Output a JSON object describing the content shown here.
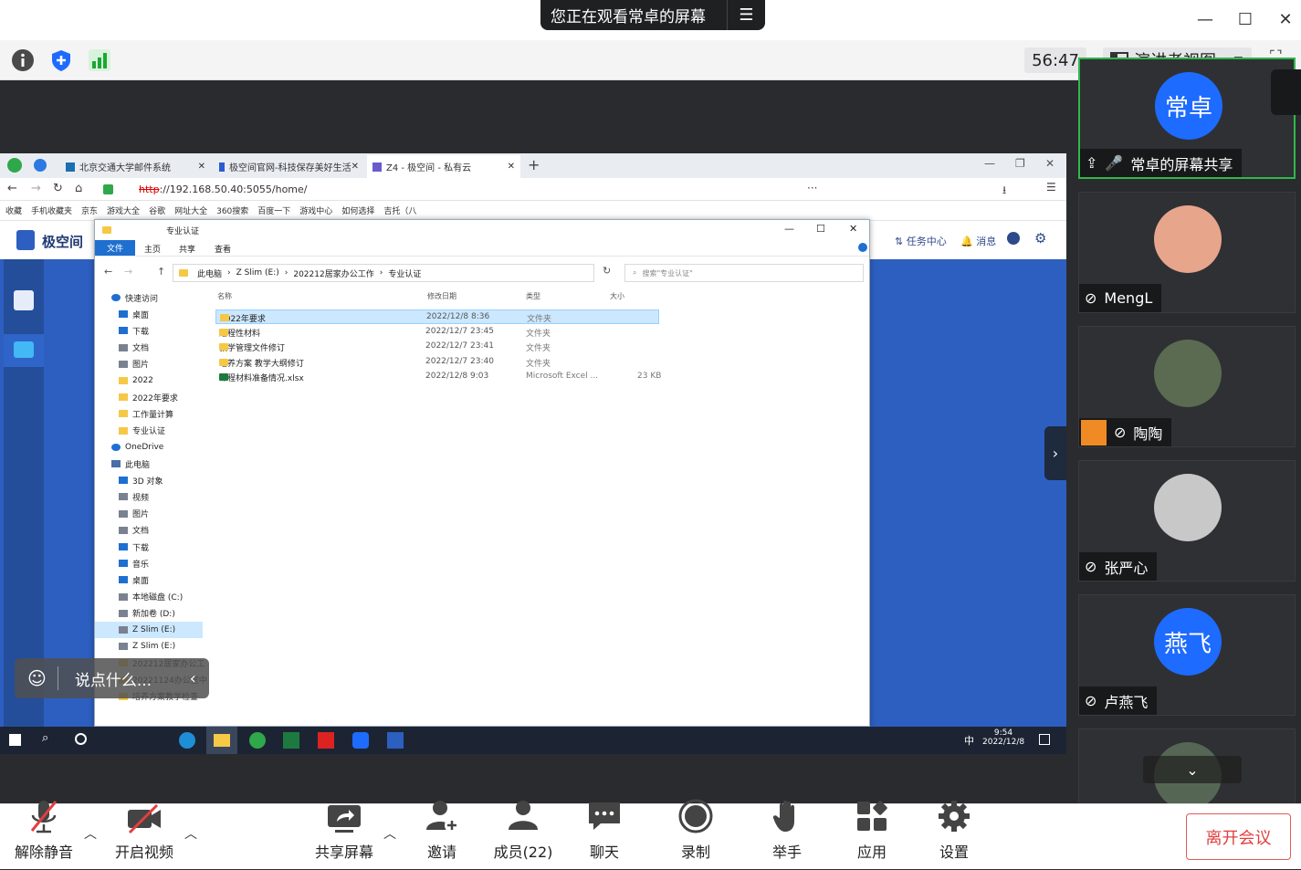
{
  "window": {
    "banner": "您正在观看常卓的屏幕",
    "controls": [
      "minimize",
      "maximize",
      "close"
    ]
  },
  "toolbar": {
    "timer": "56:47",
    "view_mode": "演讲者视图"
  },
  "browser": {
    "tabs": [
      {
        "label": "北京交通大学邮件系统"
      },
      {
        "label": "极空间官网-科技保存美好生活"
      },
      {
        "label": "Z4 - 极空间 - 私有云"
      }
    ],
    "url_scheme": "http",
    "url_rest": "://192.168.50.40:5055/home/",
    "bookmarks": [
      "收藏",
      "手机收藏夹",
      "京东",
      "游戏大全",
      "谷歌",
      "网址大全",
      "360搜索",
      "百度一下",
      "游戏中心",
      "如何选择",
      "吉托（八"
    ]
  },
  "webapp": {
    "logo": "极空间",
    "task_center": "任务中心",
    "messages": "消息"
  },
  "explorer": {
    "title": "专业认证",
    "ribbon": [
      "文件",
      "主页",
      "共享",
      "查看"
    ],
    "breadcrumb": [
      "此电脑",
      "Z Slim (E:)",
      "202212居家办公工作",
      "专业认证"
    ],
    "search_placeholder": "搜索\"专业认证\"",
    "columns": [
      "名称",
      "修改日期",
      "类型",
      "大小"
    ],
    "files": [
      {
        "name": "2022年要求",
        "date": "2022/12/8 8:36",
        "type": "文件夹",
        "size": ""
      },
      {
        "name": "过程性材料",
        "date": "2022/12/7 23:45",
        "type": "文件夹",
        "size": ""
      },
      {
        "name": "教学管理文件修订",
        "date": "2022/12/7 23:41",
        "type": "文件夹",
        "size": ""
      },
      {
        "name": "培养方案 教学大纲修订",
        "date": "2022/12/7 23:40",
        "type": "文件夹",
        "size": ""
      },
      {
        "name": "课程材料准备情况.xlsx",
        "date": "2022/12/8 9:03",
        "type": "Microsoft Excel ...",
        "size": "23 KB"
      }
    ],
    "nav": [
      {
        "label": "快速访问",
        "kind": "star"
      },
      {
        "label": "桌面",
        "kind": "blue"
      },
      {
        "label": "下载",
        "kind": "blue"
      },
      {
        "label": "文档",
        "kind": "gray"
      },
      {
        "label": "图片",
        "kind": "gray"
      },
      {
        "label": "2022",
        "kind": "folder"
      },
      {
        "label": "2022年要求",
        "kind": "folder"
      },
      {
        "label": "工作量计算",
        "kind": "folder"
      },
      {
        "label": "专业认证",
        "kind": "folder"
      },
      {
        "label": "OneDrive",
        "kind": "cloud"
      },
      {
        "label": "此电脑",
        "kind": "pc"
      },
      {
        "label": "3D 对象",
        "kind": "blue"
      },
      {
        "label": "视频",
        "kind": "gray"
      },
      {
        "label": "图片",
        "kind": "gray"
      },
      {
        "label": "文档",
        "kind": "gray"
      },
      {
        "label": "下载",
        "kind": "blue"
      },
      {
        "label": "音乐",
        "kind": "blue"
      },
      {
        "label": "桌面",
        "kind": "blue"
      },
      {
        "label": "本地磁盘 (C:)",
        "kind": "drive"
      },
      {
        "label": "新加卷 (D:)",
        "kind": "drive"
      },
      {
        "label": "Z Slim (E:)",
        "kind": "drive"
      },
      {
        "label": "Z Slim (E:)",
        "kind": "drive"
      },
      {
        "label": "202212居家办公工",
        "kind": "folder"
      },
      {
        "label": "20221124办公室中",
        "kind": "folder"
      },
      {
        "label": "培养方案教学检查",
        "kind": "folder"
      }
    ]
  },
  "taskbar": {
    "ime": "中",
    "time": "9:54",
    "date": "2022/12/8"
  },
  "chat": {
    "placeholder": "说点什么..."
  },
  "participants": [
    {
      "name": "常卓的屏幕共享",
      "avatar_text": "常卓",
      "color": "#1e6bff",
      "mic": "on",
      "sharing": true
    },
    {
      "name": "MengL",
      "avatar_text": "",
      "color": "#e7a58c",
      "mic": "muted"
    },
    {
      "name": "陶陶",
      "avatar_text": "",
      "color": "#5a6b52",
      "mic": "muted",
      "badge": true
    },
    {
      "name": "张严心",
      "avatar_text": "",
      "color": "#c8c8c8",
      "mic": "muted"
    },
    {
      "name": "卢燕飞",
      "avatar_text": "燕飞",
      "color": "#1e6bff",
      "mic": "muted"
    },
    {
      "name": "",
      "avatar_text": "",
      "color": "#556655",
      "mic": "muted"
    }
  ],
  "bottom_bar": {
    "mute": "解除静音",
    "video": "开启视频",
    "share": "共享屏幕",
    "invite": "邀请",
    "members": "成员(22)",
    "chat": "聊天",
    "record": "录制",
    "raise_hand": "举手",
    "apps": "应用",
    "settings": "设置",
    "leave": "离开会议"
  }
}
